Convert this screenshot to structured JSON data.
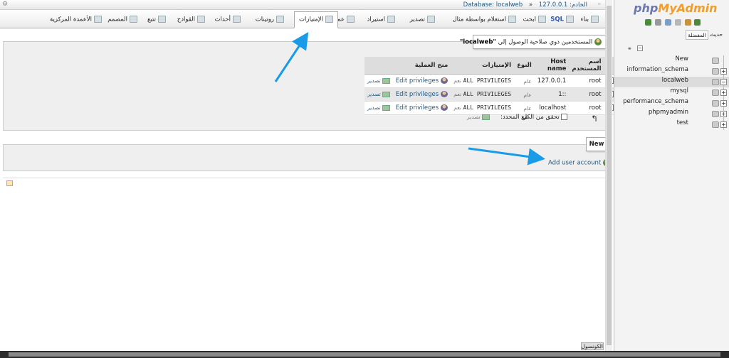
{
  "breadcrumb": {
    "server_label": "الخادم: 127.0.0.1",
    "database_label": "Database: localweb"
  },
  "tabs": [
    {
      "label": "بناء",
      "icon": "structure-icon"
    },
    {
      "label": "SQL",
      "icon": "sql-icon"
    },
    {
      "label": "ابحث",
      "icon": "search-icon"
    },
    {
      "label": "استعلام بواسطة مثال",
      "icon": "query-icon"
    },
    {
      "label": "تصدير",
      "icon": "export-icon"
    },
    {
      "label": "استيراد",
      "icon": "import-icon"
    },
    {
      "label": "عمليات",
      "icon": "wrench-icon"
    },
    {
      "label": "الإمتيازات",
      "icon": "privileges-icon",
      "active": true
    },
    {
      "label": "روتينات",
      "icon": "routines-icon"
    },
    {
      "label": "أحداث",
      "icon": "events-icon"
    },
    {
      "label": "القوادح",
      "icon": "triggers-icon"
    },
    {
      "label": "تتبع",
      "icon": "tracking-icon"
    },
    {
      "label": "المصمم",
      "icon": "designer-icon"
    },
    {
      "label": "الأعمدة المركزية",
      "icon": "central-columns-icon"
    }
  ],
  "notice": {
    "prefix": "المستخدمين ذوي صلاحية الوصول إلى",
    "db": "\"localweb\""
  },
  "users_table": {
    "headers": {
      "action": "منح العملية",
      "privileges": "الإمتيازات",
      "type": "النوع",
      "host": "Host name",
      "user": "اسم المستخدم"
    },
    "rows": [
      {
        "user": "root",
        "host": "127.0.0.1",
        "type": "عام",
        "privileges": "ALL PRIVILEGES",
        "grant": "نعم",
        "edit": "Edit privileges",
        "export": "تصدير"
      },
      {
        "user": "root",
        "host": "::1",
        "type": "عام",
        "privileges": "ALL PRIVILEGES",
        "grant": "نعم",
        "edit": "Edit privileges",
        "export": "تصدير"
      },
      {
        "user": "root",
        "host": "localhost",
        "type": "عام",
        "privileges": "ALL PRIVILEGES",
        "grant": "نعم",
        "edit": "Edit privileges",
        "export": "تصدير"
      }
    ]
  },
  "bulk": {
    "check_all": "تحقق من الكل",
    "with_selected": "مع المحدد:",
    "export": "تصدير"
  },
  "new_section": {
    "title": "New",
    "add_user": "Add user account"
  },
  "console_label": "الكونسول",
  "sidebar": {
    "logo_a": "php",
    "logo_b": "MyAdmin",
    "favorites": "المفضلة",
    "recent": "حديث",
    "tree": [
      {
        "label": "New"
      },
      {
        "label": "information_schema"
      },
      {
        "label": "localweb",
        "selected": true
      },
      {
        "label": "mysql"
      },
      {
        "label": "performance_schema"
      },
      {
        "label": "phpmyadmin"
      },
      {
        "label": "test"
      }
    ]
  },
  "colors": {
    "link": "#235a81",
    "annotation_arrow": "#1a9be8"
  }
}
